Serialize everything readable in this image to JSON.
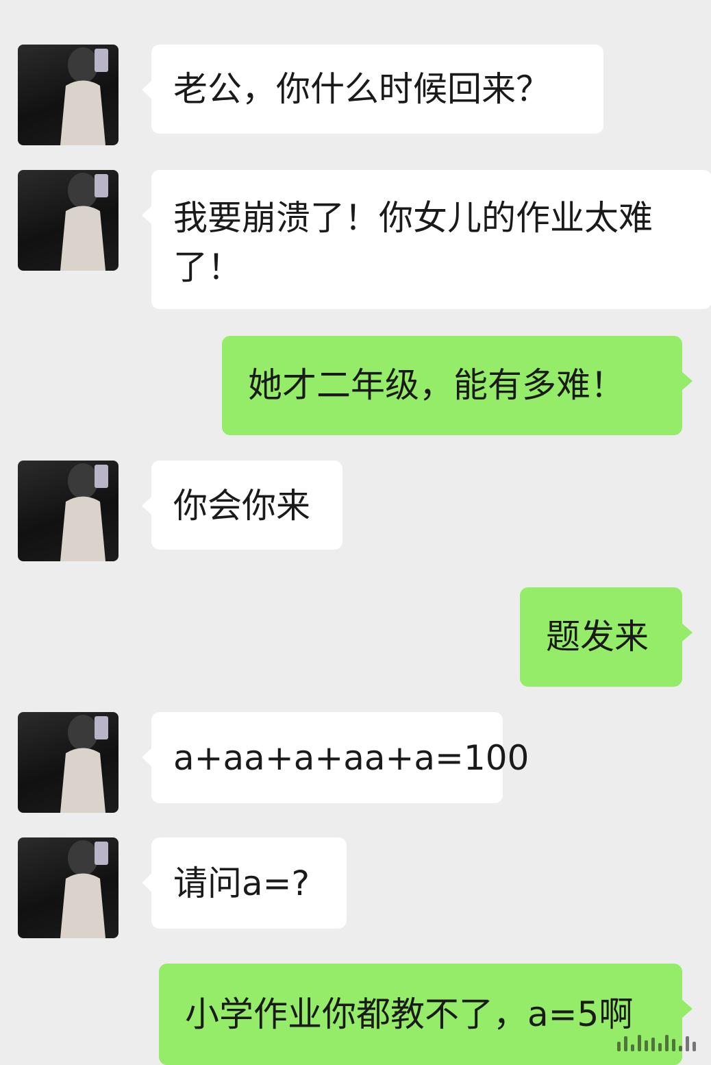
{
  "messages": [
    {
      "from": "other",
      "text": "老公，你什么时候回来？"
    },
    {
      "from": "other",
      "text": "我要崩溃了！你女儿的作业太难了！"
    },
    {
      "from": "me",
      "text": "她才二年级，能有多难！"
    },
    {
      "from": "other",
      "text": "你会你来"
    },
    {
      "from": "me",
      "text": "题发来"
    },
    {
      "from": "other",
      "text": "a+aa+a+aa+a=100"
    },
    {
      "from": "other",
      "text": "请问a=?"
    },
    {
      "from": "me",
      "text": "小学作业你都教不了，a=5啊"
    }
  ],
  "colors": {
    "background": "#ededed",
    "incoming_bubble": "#ffffff",
    "outgoing_bubble": "#95ec69"
  },
  "icons": {
    "avatar": "contact-avatar-photo"
  }
}
